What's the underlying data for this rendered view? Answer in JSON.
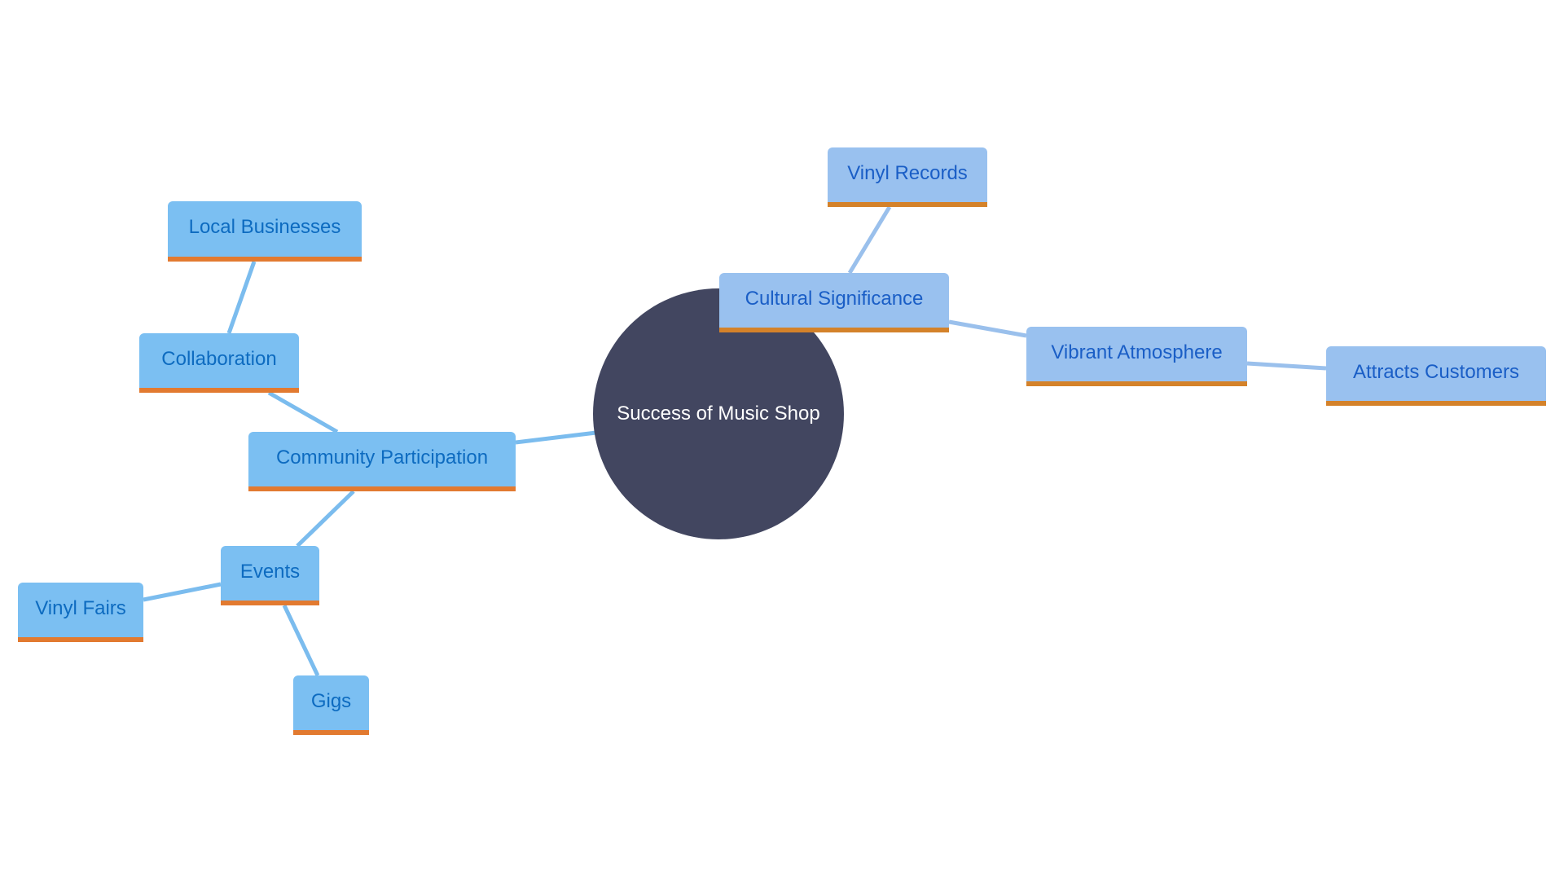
{
  "diagram": {
    "type": "mindmap",
    "root": {
      "id": "root",
      "label": "Success of Music Shop"
    },
    "nodes": [
      {
        "id": "cultural",
        "label": "Cultural Significance",
        "parent": "root",
        "branch": "right"
      },
      {
        "id": "vinylrec",
        "label": "Vinyl Records",
        "parent": "cultural",
        "branch": "right"
      },
      {
        "id": "vibrant",
        "label": "Vibrant Atmosphere",
        "parent": "cultural",
        "branch": "right"
      },
      {
        "id": "attracts",
        "label": "Attracts Customers",
        "parent": "vibrant",
        "branch": "right"
      },
      {
        "id": "community",
        "label": "Community Participation",
        "parent": "root",
        "branch": "left"
      },
      {
        "id": "collab",
        "label": "Collaboration",
        "parent": "community",
        "branch": "left"
      },
      {
        "id": "local",
        "label": "Local Businesses",
        "parent": "collab",
        "branch": "left"
      },
      {
        "id": "events",
        "label": "Events",
        "parent": "community",
        "branch": "left"
      },
      {
        "id": "vinylfairs",
        "label": "Vinyl Fairs",
        "parent": "events",
        "branch": "left"
      },
      {
        "id": "gigs",
        "label": "Gigs",
        "parent": "events",
        "branch": "left"
      }
    ],
    "colors": {
      "root_fill": "#424660",
      "root_text": "#ffffff",
      "left_fill": "#7bbff2",
      "left_text": "#0d6bc0",
      "left_edge": "#7bbcee",
      "right_fill": "#99c1ef",
      "right_text": "#1a5ec6",
      "right_edge": "#9ac0ec",
      "accent_underline": "#e0802e"
    }
  }
}
